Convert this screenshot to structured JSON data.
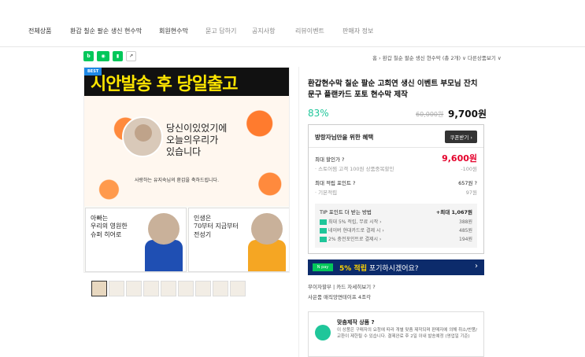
{
  "nav": {
    "tabs": [
      "전체상품",
      "환갑 칠순 팔순 생신 현수막",
      "회원현수막",
      "묻고 답하기",
      "공지사항",
      "리뷰이벤트",
      "판매자 정보"
    ]
  },
  "breadcrumb": {
    "text": "홈 › 환갑 칠순 팔순 생신 현수막 (총 2개) ∨ 다른상품보기 ∨"
  },
  "hero": {
    "badge": "BEST",
    "banner": "시안발송 후 당일출고",
    "calligraphy": [
      "당신이있었기에",
      "오늘의우리가",
      "있습니다"
    ],
    "message": "사랑하는 유지숙님의 환갑을 축하드립니다.",
    "panel_left_text": [
      "아빠는",
      "우리의 영원한",
      "슈퍼 히어로"
    ],
    "panel_right_text": [
      "인생은",
      "70부터 지금부터",
      "전성기"
    ]
  },
  "thumbs_count": 9,
  "product": {
    "title": "환갑현수막 칠순 팔순 고희연 생신 이벤트 부모님 잔치 문구 플랜카드 포토 현수막 제작",
    "discount": "83%",
    "original_price": "60,000원",
    "price": "9,700원"
  },
  "benefit": {
    "header": "방랑자님만을 위한 혜택",
    "coupon_button": "쿠폰받기 ›",
    "max_discount_label": "최대 할인가 ?",
    "max_discount_value": "9,600원",
    "store_coupon_label": "· 스토어찜 고객 100원 상품중복할인",
    "store_coupon_value": "-100원",
    "max_points_label": "최대 적립 포인트 ?",
    "max_points_value": "657원 ?",
    "basic_label": "· 기본적립",
    "basic_value": "97원",
    "tip_title": "TIP 포인트 더 받는 방법",
    "tip_max": "+최대 1,067원",
    "tip_rows": [
      {
        "label": "최대 5% 적립, 무료 시작 ›",
        "value": "388원"
      },
      {
        "label": "네이버 현대카드로 결제 시 ›",
        "value": "485원"
      },
      {
        "label": "2% 충전포인트로 결제시 ›",
        "value": "194원"
      }
    ]
  },
  "npay": {
    "badge": "N pay",
    "text_prefix": "5% 적립",
    "text_suffix": " 포기하시겠어요?",
    "arrow": "›"
  },
  "shipping": {
    "line1": "무이자할부 | 카드 자세히보기 ?",
    "line2": "사은품   매직앙면테이프 4조각"
  },
  "custom": {
    "title": "맞춤제작 상품 ?",
    "desc": "이 상품은 구매자의 요청에 따라 개별 맞춤 제작되며 판매자에 의해 취소/반품/교환이 제한될 수 있습니다. 결제완료 후 2일 이내 발송예정 (영업일 기준)"
  },
  "colors": {
    "accent_green": "#1fc69a",
    "price_red": "#e4002b",
    "npay_navy": "#0c2b6b"
  }
}
